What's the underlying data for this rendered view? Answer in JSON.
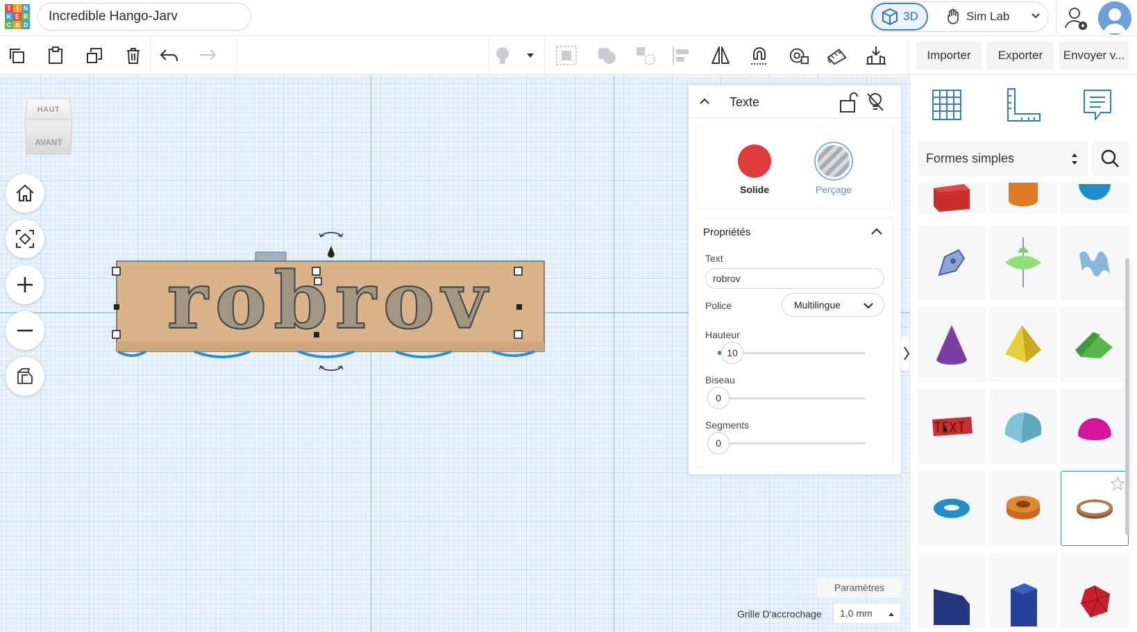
{
  "app": {
    "logo_letters": [
      "T",
      "I",
      "N",
      "K",
      "E",
      "R",
      "C",
      "A",
      "D"
    ],
    "project_name": "Incredible Hango-Jarv",
    "mode_3d_label": "3D",
    "sim_lab_label": "Sim Lab"
  },
  "toolbar": {
    "left_icons": [
      "copy-icon",
      "paste-icon",
      "duplicate-icon",
      "delete-icon",
      "undo-icon",
      "redo-icon"
    ],
    "right_icons": [
      "light-bulb-icon",
      "group-icon",
      "ungroup-icon",
      "align-icon",
      "mirror-icon",
      "cruise-icon",
      "workplane-icon",
      "ruler-icon",
      "drop-icon",
      "import-icon"
    ],
    "import_label": "Importer",
    "export_label": "Exporter",
    "send_label": "Envoyer v..."
  },
  "viewcube": {
    "top_label": "HAUT",
    "front_label": "AVANT"
  },
  "shape": {
    "text": "robrov",
    "color": "#d9b48a"
  },
  "inspector": {
    "title": "Texte",
    "solid_label": "Solide",
    "hole_label": "Perçage",
    "solid_color": "#e03a3a",
    "properties_title": "Propriétés",
    "text_label": "Text",
    "text_value": "robrov",
    "font_label": "Police",
    "font_value": "Multilingue",
    "height_label": "Hauteur",
    "height_value": "10",
    "bevel_label": "Biseau",
    "bevel_value": "0",
    "segments_label": "Segments",
    "segments_value": "0"
  },
  "right_panel": {
    "tab_icons": [
      "grid-icon",
      "ruler-corner-icon",
      "notes-icon"
    ],
    "category": "Formes simples"
  },
  "footer": {
    "params_label": "Paramètres",
    "snap_label": "Grille D'accrochage",
    "snap_value": "1,0 mm"
  }
}
